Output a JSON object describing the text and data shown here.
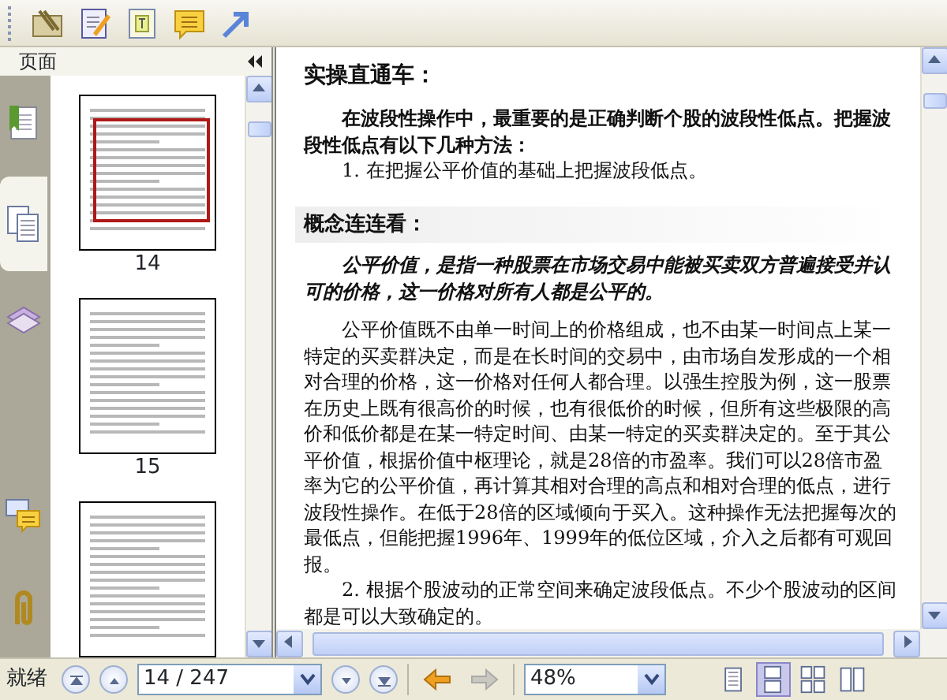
{
  "side_panel": {
    "title": "页面",
    "side_tabs": [
      {
        "kind": "bookmarks",
        "selected": false
      },
      {
        "kind": "pages",
        "selected": true
      },
      {
        "kind": "layers",
        "selected": false
      },
      {
        "kind": "comments",
        "selected": false
      },
      {
        "kind": "attachments",
        "selected": false
      }
    ],
    "thumbnails": [
      {
        "label": "14",
        "selected": true
      },
      {
        "label": "15",
        "selected": false
      },
      {
        "selected": false
      }
    ]
  },
  "document": {
    "blocks": [
      {
        "kind": "title",
        "text": "实操直通车："
      },
      {
        "kind": "lead",
        "text": "在波段性操作中，最重要的是正确判断个股的波段性低点。把握波段性低点有以下几种方法："
      },
      {
        "kind": "item",
        "text": "1. 在把握公平价值的基础上把握波段低点。"
      },
      {
        "kind": "heading",
        "text": "概念连连看："
      },
      {
        "kind": "definition",
        "text": "公平价值，是指一种股票在市场交易中能被买卖双方普遍接受并认可的价格，这一价格对所有人都是公平的。"
      },
      {
        "kind": "para",
        "text": "公平价值既不由单一时间上的价格组成，也不由某一时间点上某一特定的买卖群决定，而是在长时间的交易中，由市场自发形成的一个相对合理的价格，这一价格对任何人都合理。以强生控股为例，这一股票在历史上既有很高价的时候，也有很低价的时候，但所有这些极限的高价和低价都是在某一特定时间、由某一特定的买卖群决定的。至于其公平价值，根据价值中枢理论，就是28倍的市盈率。我们可以28倍市盈率为它的公平价值，再计算其相对合理的高点和相对合理的低点，进行波段性操作。在低于28倍的区域倾向于买入。这种操作无法把握每次的最低点，但能把握1996年、1999年的低位区域，介入之后都有可观回报。"
      },
      {
        "kind": "item",
        "text": "2. 根据个股波动的正常空间来确定波段低点。不少个股波动的区间都是可以大致确定的。"
      }
    ]
  },
  "status_bar": {
    "status": "就绪",
    "page": "14 / 247",
    "back": {
      "disabled": false
    },
    "forward": {
      "disabled": true
    },
    "zoom": "48%",
    "view_modes": [
      {
        "kind": "single",
        "selected": false
      },
      {
        "kind": "continuous",
        "selected": true
      },
      {
        "kind": "facing",
        "selected": false
      },
      {
        "kind": "continuous_facing",
        "selected": false
      }
    ]
  }
}
